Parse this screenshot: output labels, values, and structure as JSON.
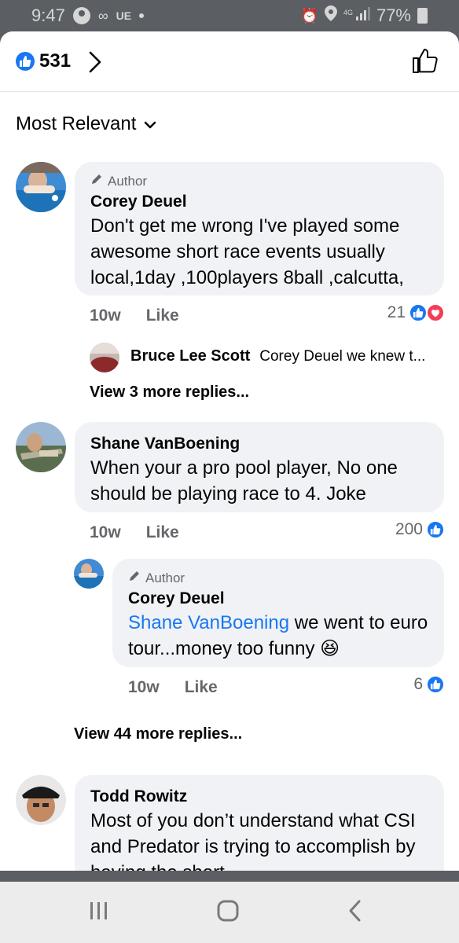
{
  "status_bar": {
    "time": "9:47",
    "carrier": "UE",
    "battery": "77%"
  },
  "header": {
    "reaction_count": "531",
    "reaction_type": "like"
  },
  "sort": {
    "label": "Most Relevant"
  },
  "comments": [
    {
      "author_tag": "Author",
      "name": "Corey Deuel",
      "text": "Don't get me wrong I've played some awesome short race events usually local,1day ,100players 8ball ,calcutta,",
      "time": "10w",
      "like_label": "Like",
      "reactions": "21",
      "reply_preview": {
        "name": "Bruce Lee Scott",
        "text": "Corey Deuel we knew t..."
      },
      "view_more": "View 3 more replies..."
    },
    {
      "name": "Shane VanBoening",
      "text": "When your a pro pool player, No one should be playing race to 4. Joke",
      "time": "10w",
      "like_label": "Like",
      "reactions": "200",
      "reply": {
        "author_tag": "Author",
        "name": "Corey Deuel",
        "mention": "Shane VanBoening",
        "text": " we went to euro tour...money too funny 😆",
        "time": "10w",
        "like_label": "Like",
        "reactions": "6"
      },
      "view_more": "View 44 more replies..."
    },
    {
      "name": "Todd Rowitz",
      "text": "Most of you don’t understand what CSI and Predator is trying to accomplish by having the short"
    }
  ],
  "colors": {
    "accent": "#1877f2",
    "love": "#f33e58",
    "bubble": "#f0f2f5",
    "muted": "#65676b"
  }
}
